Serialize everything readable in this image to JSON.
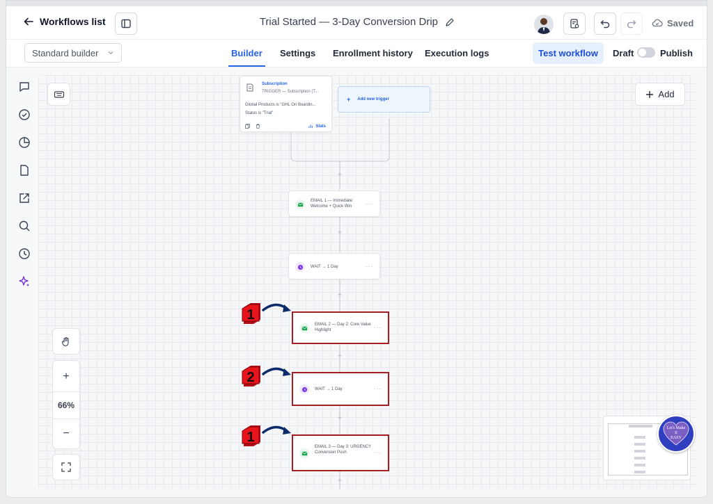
{
  "header": {
    "back_label": "Workflows list",
    "title": "Trial Started — 3-Day Conversion Drip",
    "saved_label": "Saved"
  },
  "subbar": {
    "builder_select": "Standard builder",
    "tabs": [
      {
        "label": "Builder",
        "active": true
      },
      {
        "label": "Settings",
        "active": false
      },
      {
        "label": "Enrollment history",
        "active": false
      },
      {
        "label": "Execution logs",
        "active": false
      }
    ],
    "test_workflow": "Test workflow",
    "draft_label": "Draft",
    "publish_label": "Publish"
  },
  "leftnav": {
    "icons": [
      "chat-icon",
      "check-circle-icon",
      "pie-chart-icon",
      "document-icon",
      "external-link-icon",
      "search-icon",
      "history-icon",
      "sparkle-icon"
    ]
  },
  "canvas": {
    "add_label": "Add",
    "trigger": {
      "title": "Subscription",
      "subtitle": "TRIGGER — Subscription (T...",
      "filter_1": "Global Products is \"GHL On Boardin...",
      "filter_2": "Status is \"Trial\"",
      "stats_label": "Stats"
    },
    "add_trigger_label": "Add new trigger",
    "steps": [
      {
        "type": "email",
        "label": "EMAIL 1 — Immediate: Welcome + Quick Win",
        "highlight": false
      },
      {
        "type": "wait",
        "label": "WAIT → 1 Day",
        "highlight": false
      },
      {
        "type": "email",
        "label": "EMAIL 2 — Day 2: Core Value Highlight",
        "highlight": true,
        "marker": "1"
      },
      {
        "type": "wait",
        "label": "WAIT → 1 Day",
        "highlight": true,
        "marker": "2"
      },
      {
        "type": "email",
        "label": "EMAIL 3 — Day 3: URGENCY Conversion Push",
        "highlight": true,
        "marker": "1"
      }
    ],
    "zoom_level": "66%",
    "badge_text": "Let's Make It EASY"
  },
  "colors": {
    "accent": "#2563eb",
    "highlight": "#a61e22",
    "marker_red": "#e8141c",
    "arrow": "#0d2a6b",
    "email_icon": "#16a34a",
    "wait_icon": "#7c3aed"
  }
}
